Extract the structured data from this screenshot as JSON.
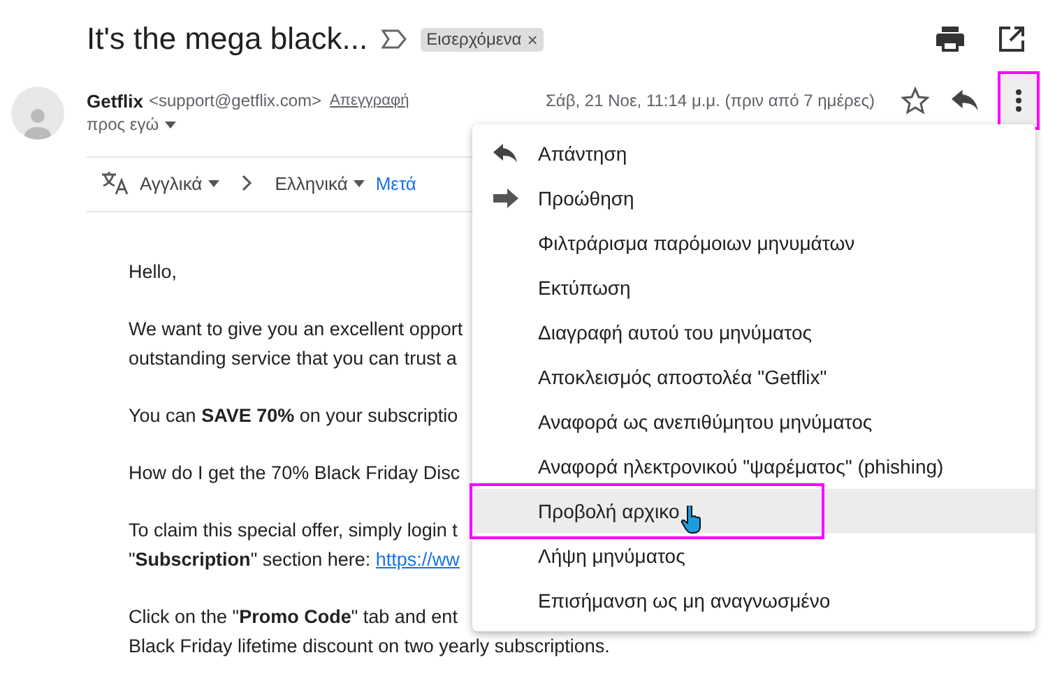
{
  "subject": "It's the mega black...",
  "label": {
    "text": "Εισερχόμενα",
    "close": "×"
  },
  "sender": {
    "name": "Getflix",
    "email": "<support@getflix.com>",
    "unsubscribe": "Απεγγραφή",
    "date": "Σάβ, 21 Νοε, 11:14 μ.μ. (πριν από 7 ημέρες)",
    "to": "προς εγώ",
    "more_outlined": true
  },
  "translate": {
    "from": "Αγγλικά",
    "to": "Ελληνικά",
    "action": "Μετά"
  },
  "body": [
    {
      "lines": [
        "Hello,"
      ]
    },
    {
      "lines": [
        "We want to give you an excellent opport",
        "outstanding service that you can trust a"
      ]
    },
    {
      "lines": [
        "You can **SAVE 70%** on your subscriptio"
      ]
    },
    {
      "lines": [
        "How do I get the 70% Black Friday Disc"
      ]
    },
    {
      "lines": [
        "To claim this special offer, simply login t",
        "\"**Subscription**\" section here: "
      ],
      "link": "https://ww"
    },
    {
      "lines": [
        "Click on the \"**Promo Code**\" tab and ent",
        "Black Friday lifetime discount on two yearly subscriptions."
      ]
    }
  ],
  "menu": [
    {
      "label": "Απάντηση",
      "kind": "reply",
      "selected": false,
      "outlined": false
    },
    {
      "label": "Προώθηση",
      "kind": "forward",
      "selected": false,
      "outlined": false
    },
    {
      "label": "Φιλτράρισμα παρόμοιων μηνυμάτων",
      "kind": "plain",
      "selected": false,
      "outlined": false
    },
    {
      "label": "Εκτύπωση",
      "kind": "plain",
      "selected": false,
      "outlined": false
    },
    {
      "label": "Διαγραφή αυτού του μηνύματος",
      "kind": "plain",
      "selected": false,
      "outlined": false
    },
    {
      "label": "Αποκλεισμός αποστολέα \"Getflix\"",
      "kind": "plain",
      "selected": false,
      "outlined": false
    },
    {
      "label": "Αναφορά ως ανεπιθύμητου μηνύματος",
      "kind": "plain",
      "selected": false,
      "outlined": false
    },
    {
      "label": "Αναφορά ηλεκτρονικού \"ψαρέματος\" (phishing)",
      "kind": "plain",
      "selected": false,
      "outlined": false
    },
    {
      "label": "Προβολή αρχικο",
      "kind": "plain",
      "selected": true,
      "outlined": true
    },
    {
      "label": "Λήψη μηνύματος",
      "kind": "plain",
      "selected": false,
      "outlined": false
    },
    {
      "label": "Επισήμανση ως μη αναγνωσμένο",
      "kind": "plain",
      "selected": false,
      "outlined": false
    }
  ]
}
